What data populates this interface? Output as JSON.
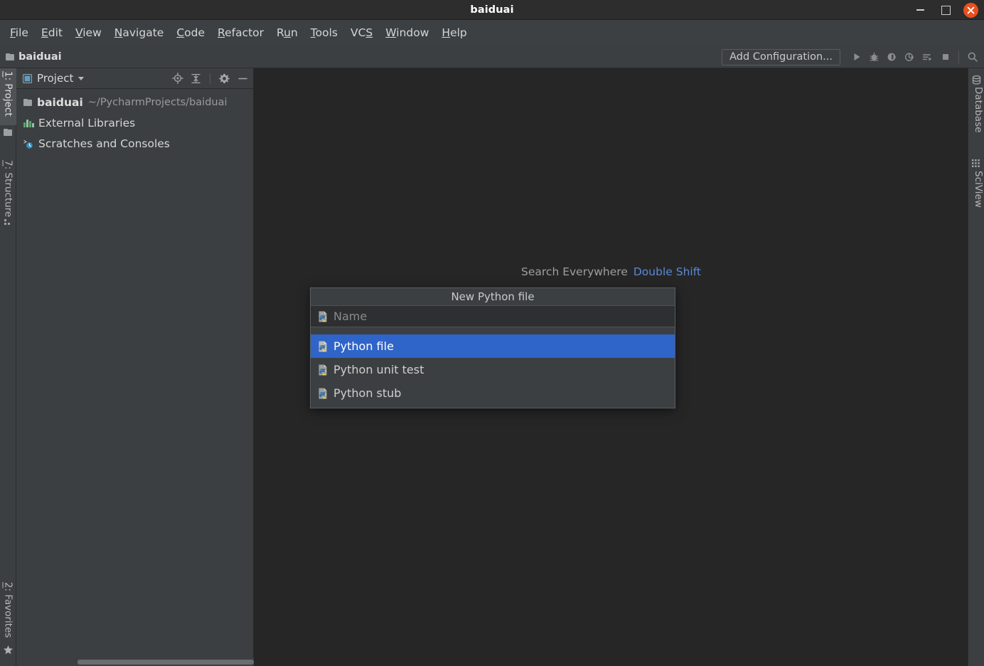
{
  "window": {
    "title": "baiduai",
    "controls": {
      "minimize": "minimize-button",
      "maximize": "maximize-button",
      "close": "close-button"
    }
  },
  "menubar": {
    "items": [
      {
        "label": "File",
        "mnemonic": "F"
      },
      {
        "label": "Edit",
        "mnemonic": "E"
      },
      {
        "label": "View",
        "mnemonic": "V"
      },
      {
        "label": "Navigate",
        "mnemonic": "N"
      },
      {
        "label": "Code",
        "mnemonic": "C"
      },
      {
        "label": "Refactor",
        "mnemonic": "R"
      },
      {
        "label": "Run",
        "mnemonic": "u"
      },
      {
        "label": "Tools",
        "mnemonic": "T"
      },
      {
        "label": "VCS",
        "mnemonic": "S"
      },
      {
        "label": "Window",
        "mnemonic": "W"
      },
      {
        "label": "Help",
        "mnemonic": "H"
      }
    ]
  },
  "navbar": {
    "breadcrumb": "baiduai",
    "add_configuration": "Add Configuration...",
    "run_icons": [
      "run-icon",
      "debug-icon",
      "run-with-coverage-icon",
      "profile-icon",
      "run-with-console-icon",
      "stop-icon"
    ],
    "search_icon": "search-icon"
  },
  "left_tool_tabs": [
    {
      "label": "1: Project",
      "mnemonic": "1",
      "icon": "project-folder-icon",
      "active": true
    },
    {
      "label": "7: Structure",
      "mnemonic": "7",
      "icon": "structure-icon",
      "active": false
    },
    {
      "label": "2: Favorites",
      "mnemonic": "2",
      "icon": "star-icon",
      "active": false
    }
  ],
  "right_tool_tabs": [
    {
      "label": "Database",
      "icon": "database-icon"
    },
    {
      "label": "SciView",
      "icon": "sciview-icon"
    }
  ],
  "project_panel": {
    "title": "Project",
    "view_icon": "project-view-icon",
    "dropdown_icon": "chevron-down-icon",
    "actions": [
      {
        "name": "select-opened-file-icon",
        "tooltip": "Select Opened File"
      },
      {
        "name": "collapse-all-icon",
        "tooltip": "Collapse All"
      },
      {
        "name": "gear-icon",
        "tooltip": "Settings"
      },
      {
        "name": "hide-icon",
        "tooltip": "Hide"
      }
    ],
    "tree": [
      {
        "label": "baiduai",
        "sublabel": "~/PycharmProjects/baiduai",
        "icon": "folder-icon",
        "bold": true
      },
      {
        "label": "External Libraries",
        "sublabel": "",
        "icon": "external-libraries-icon",
        "bold": false
      },
      {
        "label": "Scratches and Consoles",
        "sublabel": "",
        "icon": "scratches-icon",
        "bold": false
      }
    ]
  },
  "editor": {
    "search_everywhere": {
      "label": "Search Everywhere",
      "shortcut": "Double Shift"
    }
  },
  "new_file_popup": {
    "title": "New Python file",
    "name_placeholder": "Name",
    "name_value": "",
    "name_icon": "python-file-icon",
    "options": [
      {
        "label": "Python file",
        "icon": "python-file-icon",
        "selected": true
      },
      {
        "label": "Python unit test",
        "icon": "python-file-icon",
        "selected": false
      },
      {
        "label": "Python stub",
        "icon": "python-file-icon",
        "selected": false
      }
    ]
  },
  "colors": {
    "accent_selection": "#2F64C8",
    "shortcut_link": "#5989D6",
    "close_button": "#E8501E",
    "panel_background": "#3C3F41",
    "editor_background": "#262626",
    "titlebar_background": "#2D2D2D"
  }
}
